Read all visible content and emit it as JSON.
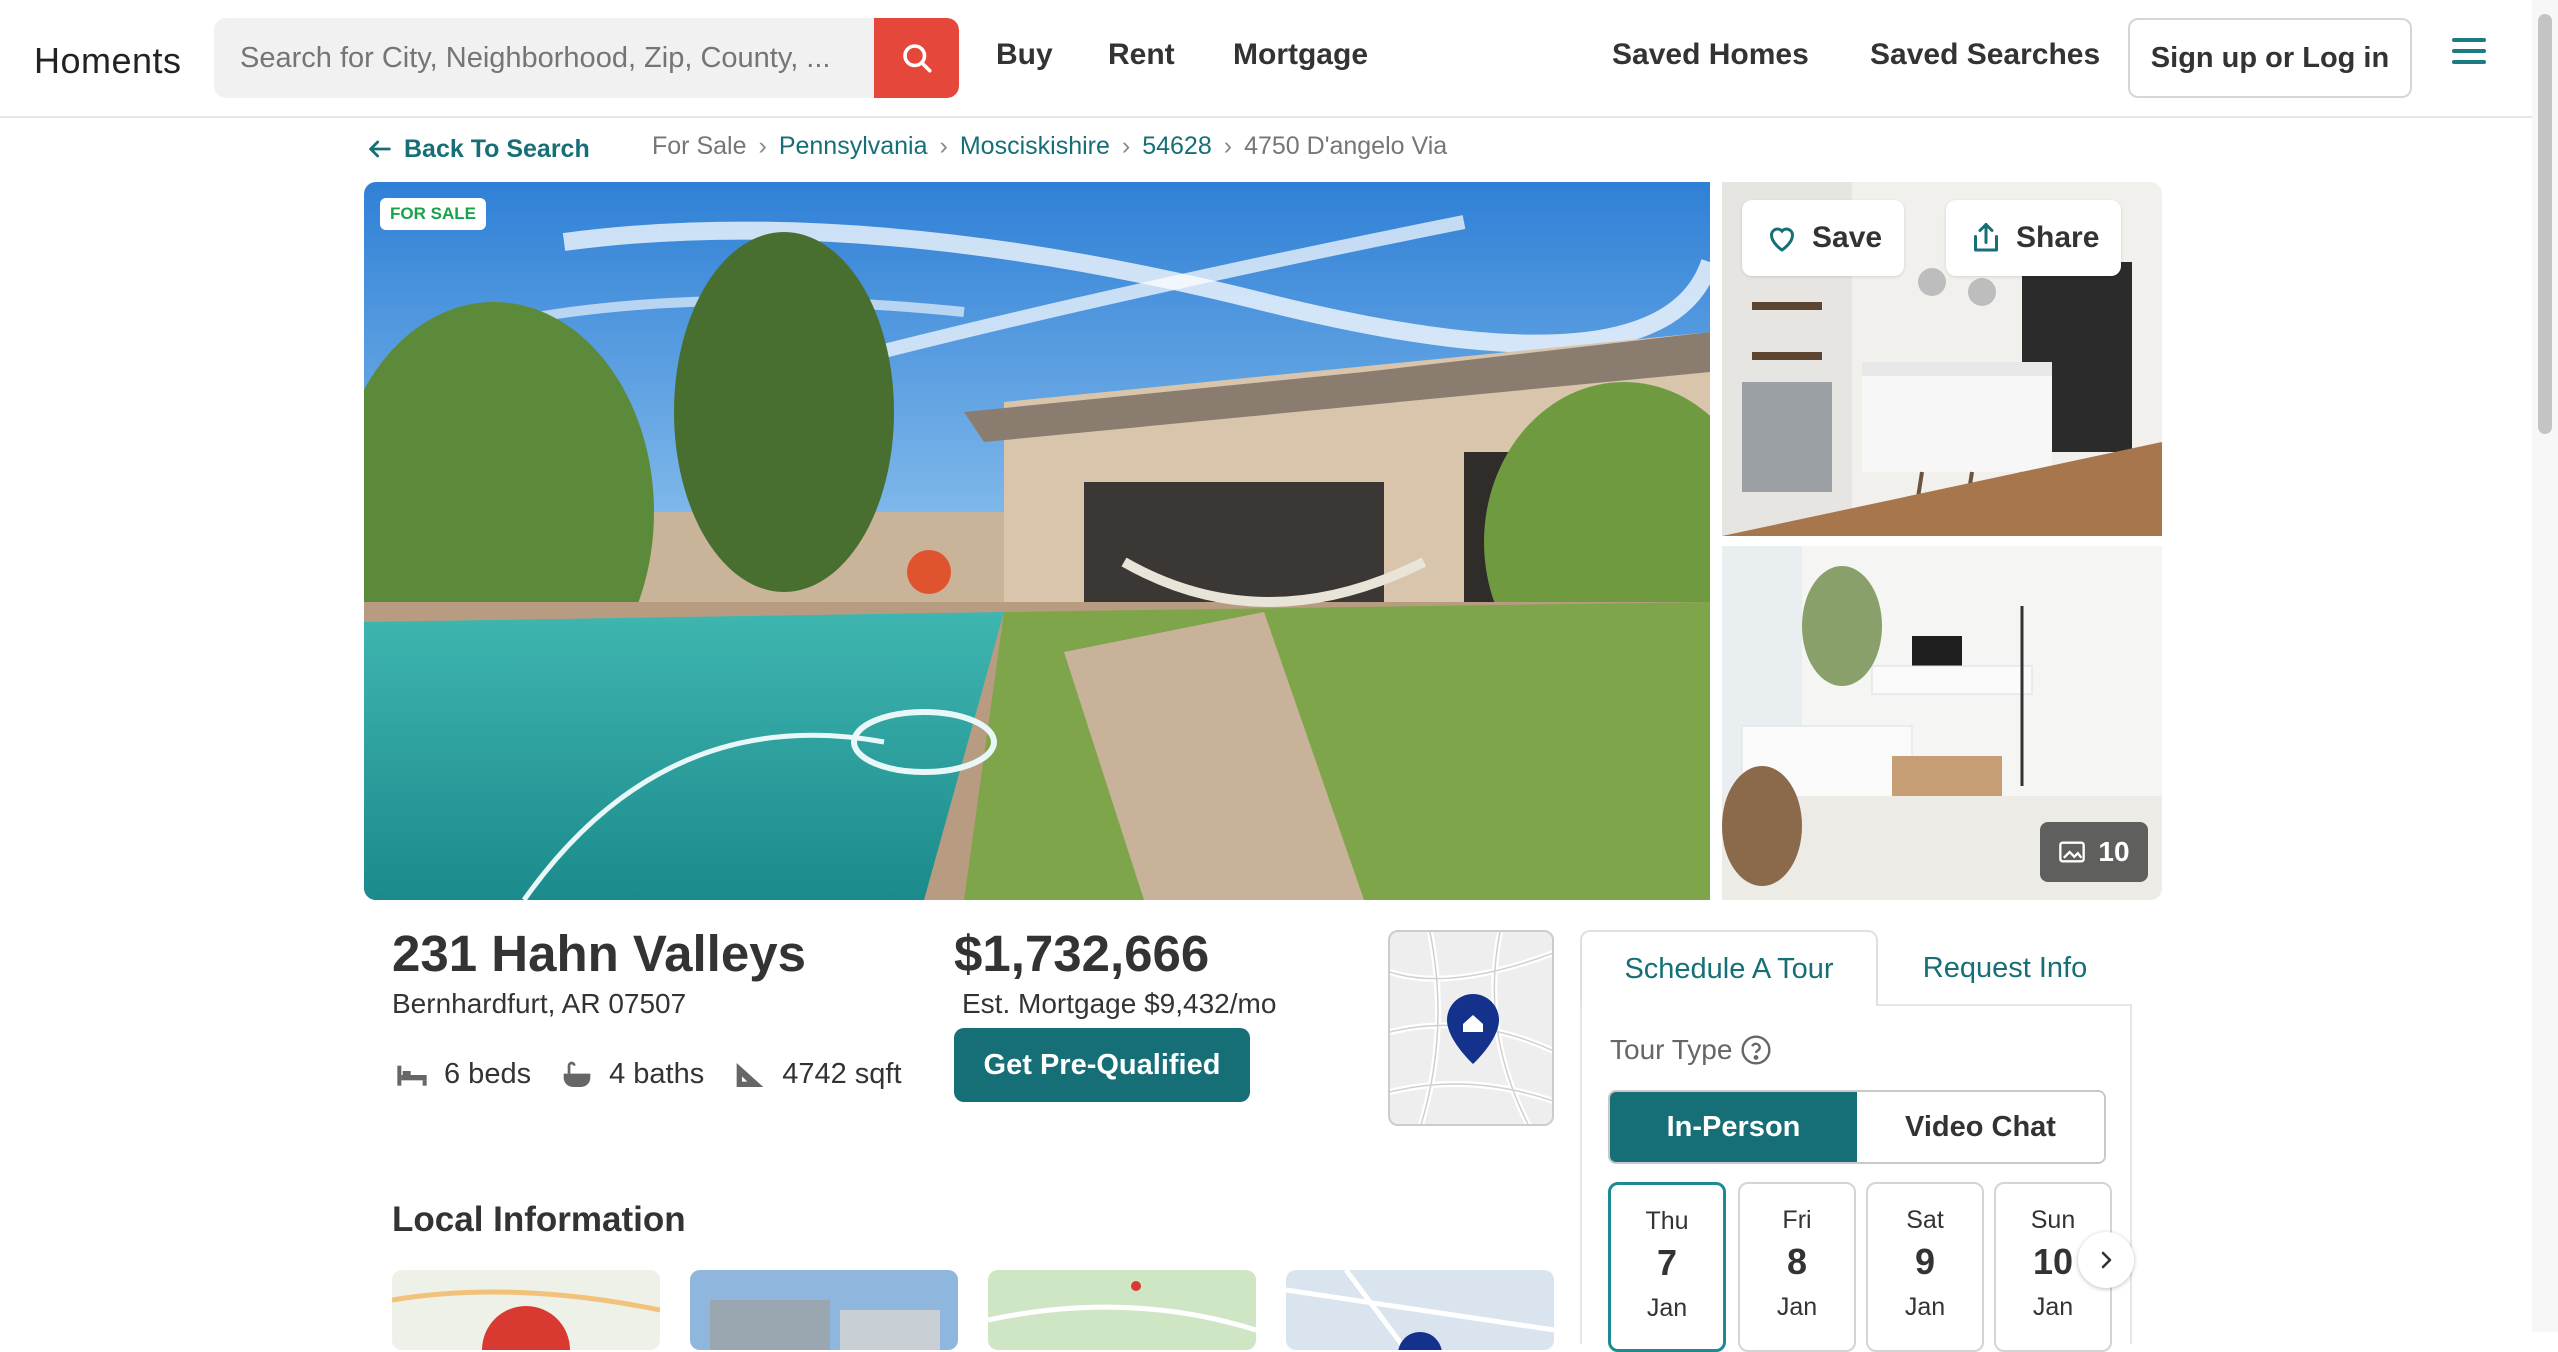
{
  "header": {
    "logo": "Homents",
    "search_placeholder": "Search for City, Neighborhood, Zip, County, ...",
    "nav": [
      "Buy",
      "Rent",
      "Mortgage",
      "Saved Homes",
      "Saved Searches"
    ],
    "login_label": "Sign up or Log in"
  },
  "breadcrumb": {
    "back": "Back To Search",
    "items": [
      "For Sale",
      "Pennsylvania",
      "Mosciskishire",
      "54628",
      "4750 D'angelo Via"
    ]
  },
  "gallery": {
    "badge": "FOR SALE",
    "save_label": "Save",
    "share_label": "Share",
    "photo_count": "10"
  },
  "listing": {
    "address": "231 Hahn Valleys",
    "city_line": "Bernhardfurt, AR 07507",
    "beds": "6 beds",
    "baths": "4 baths",
    "sqft": "4742 sqft",
    "price": "$1,732,666",
    "mortgage": "Est. Mortgage $9,432/mo",
    "prequal_label": "Get Pre-Qualified"
  },
  "local": {
    "title": "Local Information"
  },
  "tour": {
    "tabs": [
      "Schedule A Tour",
      "Request Info"
    ],
    "tour_type_label": "Tour Type",
    "options": [
      "In-Person",
      "Video Chat"
    ],
    "days": [
      {
        "dow": "Thu",
        "num": "7",
        "mon": "Jan"
      },
      {
        "dow": "Fri",
        "num": "8",
        "mon": "Jan"
      },
      {
        "dow": "Sat",
        "num": "9",
        "mon": "Jan"
      },
      {
        "dow": "Sun",
        "num": "10",
        "mon": "Jan"
      }
    ]
  },
  "colors": {
    "accent": "#166f77",
    "search_button": "#e5483b",
    "badge_text": "#18a34a"
  }
}
